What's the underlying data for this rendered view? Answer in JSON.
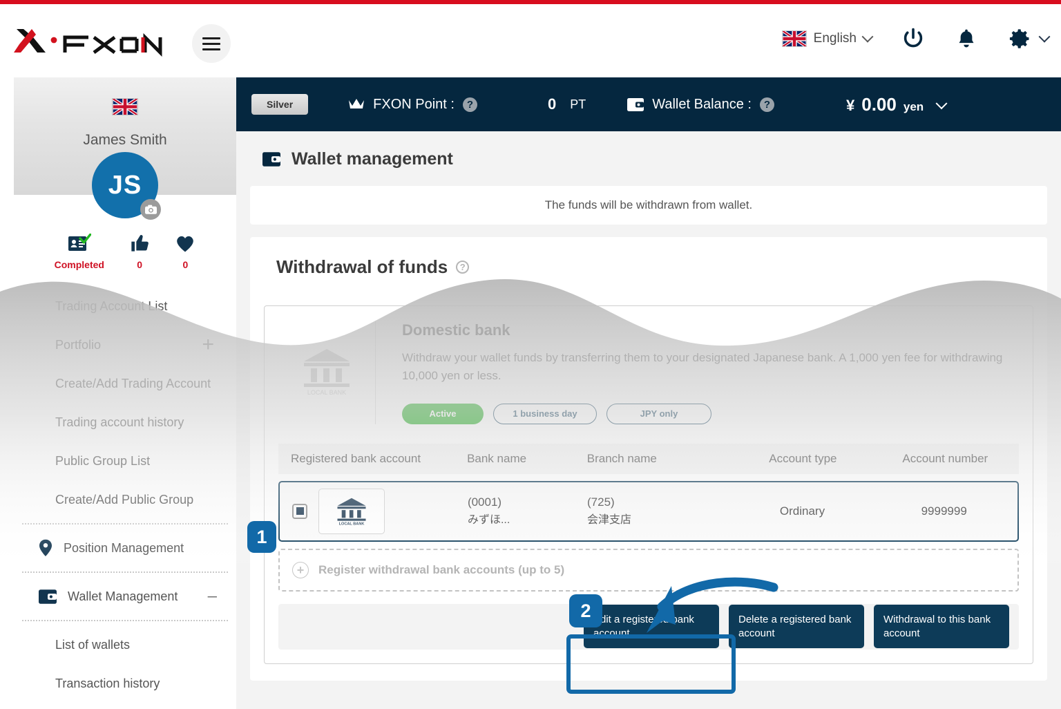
{
  "header": {
    "logo_text": "FXON",
    "menu_icon": "hamburger-icon",
    "language": "English",
    "icons": [
      "power-icon",
      "bell-icon",
      "gear-icon"
    ]
  },
  "subbar": {
    "rank_badge": "Silver",
    "point_label": "FXON Point :",
    "point_value": "0",
    "point_unit": "PT",
    "balance_label": "Wallet Balance :",
    "balance_symbol": "¥",
    "balance_value": "0.00",
    "balance_currency": "yen"
  },
  "sidebar": {
    "user_name": "James Smith",
    "avatar_initials": "JS",
    "stats": [
      {
        "icon": "id-card-check-icon",
        "label": "Completed"
      },
      {
        "icon": "thumbs-up-icon",
        "label": "0"
      },
      {
        "icon": "heart-icon",
        "label": "0"
      }
    ],
    "items": [
      {
        "label": "Trading Account List",
        "type": "sub"
      },
      {
        "label": "Portfolio",
        "type": "sub",
        "trailing": "+"
      },
      {
        "label": "Create/Add Trading Account",
        "type": "sub"
      },
      {
        "label": "Trading account history",
        "type": "sub"
      },
      {
        "label": "Public Group List",
        "type": "sub"
      },
      {
        "label": "Create/Add Public Group",
        "type": "sub"
      },
      {
        "label": "Position Management",
        "type": "group",
        "icon": "location-pin-icon"
      },
      {
        "label": "Wallet Management",
        "type": "group",
        "icon": "wallet-icon",
        "trailing": "–"
      },
      {
        "label": "List of wallets",
        "type": "sub"
      },
      {
        "label": "Transaction history",
        "type": "sub"
      }
    ]
  },
  "main": {
    "page_title": "Wallet management",
    "page_title_icon": "wallet-icon",
    "notice": "The funds will be withdrawn from wallet.",
    "section_title": "Withdrawal of funds",
    "card": {
      "logo_caption": "LOCAL BANK",
      "title": "Domestic bank",
      "description": "Withdraw your wallet funds by transferring them to your designated Japanese bank. A 1,000 yen fee for withdrawing 10,000 yen or less.",
      "pills": [
        {
          "label": "Active",
          "style": "active"
        },
        {
          "label": "1 business day",
          "style": "outline"
        },
        {
          "label": "JPY only",
          "style": "outline"
        }
      ],
      "table": {
        "columns": [
          "Registered bank account",
          "Bank name",
          "Branch name",
          "Account type",
          "Account number"
        ],
        "rows": [
          {
            "selected": true,
            "logo_caption": "LOCAL BANK",
            "bank_code": "(0001)",
            "bank_name": "みずほ...",
            "branch_code": "(725)",
            "branch_name": "会津支店",
            "account_type": "Ordinary",
            "account_number": "9999999"
          }
        ]
      },
      "register_row": "Register withdrawal bank accounts (up to 5)",
      "buttons": [
        "Edit a registered bank account",
        "Delete a registered bank account",
        "Withdrawal to this bank account"
      ]
    }
  },
  "annotations": {
    "badge_1": "1",
    "badge_2": "2",
    "accent_color": "#1269a8"
  }
}
